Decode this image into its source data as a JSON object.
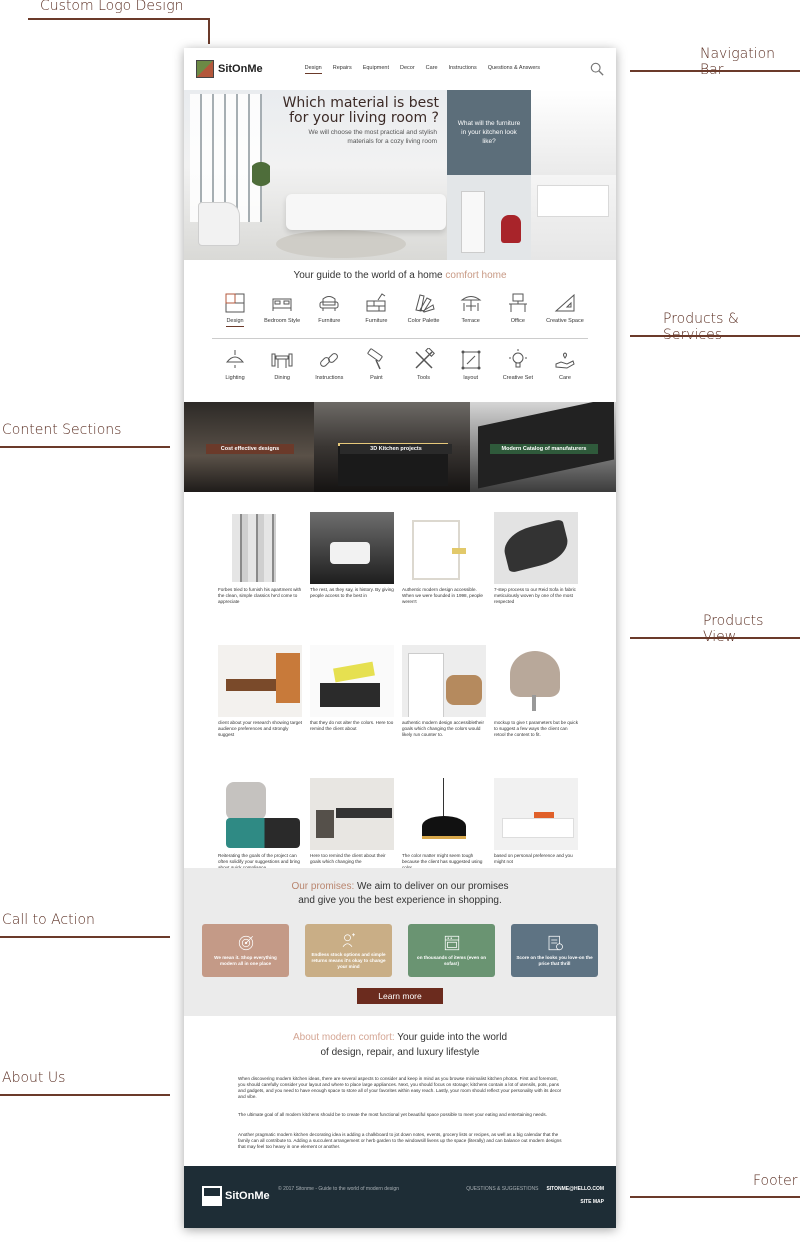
{
  "annotations": {
    "logo": "Custom Logo Design",
    "nav": "Navigation Bar",
    "products_services": "Products & Services",
    "content_sections": "Content Sections",
    "products_view": "Products View",
    "cta": "Call to Action",
    "about": "About Us",
    "footer": "Footer"
  },
  "nav": {
    "logo_text": "SitOnMe",
    "links": [
      "Design",
      "Repairs",
      "Equipment",
      "Decor",
      "Care",
      "Instructions",
      "Questions & Answers"
    ]
  },
  "hero": {
    "title_line1": "Which material is best",
    "title_line2": "for your living room ?",
    "subtitle": "We will choose the most practical and stylish materials for a cozy living room",
    "side_tile": "What will the furniture in your kitchen look like?"
  },
  "guide": {
    "title_prefix": "Your guide to the world of a home",
    "title_accent": "comfort home",
    "row1": [
      "Design",
      "Bedroom Style",
      "Furniture",
      "Furniture",
      "Color Palette",
      "Terrace",
      "Office",
      "Creative Space"
    ],
    "row2": [
      "Lighting",
      "Dining",
      "Instructions",
      "Paint",
      "Tools",
      "layout",
      "Creative Set",
      "Care"
    ]
  },
  "banners": [
    "Cost effective designs",
    "3D Kitchen projects",
    "Modern Catalog of manufaturers"
  ],
  "products": [
    "Forbes tried to furnish his apartment with the clean, simple classics he'd come to appreciate",
    "The rest, as they say, is history. By giving people access to the best in",
    "Authentic modern design accessible. When we were founded in 1998, people weren't",
    "7-step process to our Reid Sofa in fabric meticulously woven by one of the most respected",
    "client about your research showing target audience preferences and strongly suggest",
    "that they do not alter the colors. Here too remind the client about",
    "authentic modern design accessibletheir goals which changing the colors would likely run counter to.",
    "mockup to give t parameters but be quick to suggest a few ways the client can retool the content to fit.",
    "Reiterating the goals of the project can often solidify your suggestions and bring about quick compliance.",
    "Here too remind the client about their goals which changing the",
    "The color matter might seem tough because the client has suggested using color",
    "based on personal preference and you might not"
  ],
  "promises": {
    "title_accent": "Our promises:",
    "title_rest": "We aim to deliver on our promises",
    "title_line2": "and give you the best experience in shopping.",
    "cards": [
      {
        "text": "We mean it. Shop everything modern all in one place",
        "color": "#c49a87"
      },
      {
        "text": "Endless stock options and simple returns means it's okay to change your mind",
        "color": "#c9ae86"
      },
      {
        "text": "on thousands of items (even on sofas!)",
        "color": "#6a9472"
      },
      {
        "text": "Score on the looks you love-on the price that thrill",
        "color": "#5e7383"
      }
    ],
    "button": "Learn more"
  },
  "about": {
    "title_accent": "About modern comfort:",
    "title_rest": "Your guide into the world",
    "title_line2": "of design, repair, and luxury lifestyle",
    "p1": "When discovering modern kitchen ideas, there are several aspects to consider and keep in mind as you browse minimalist kitchen photos. First and foremost, you should carefully consider your layout and where to place large appliances. Next, you should focus on storage; kitchens contain a lot of utensils, pots, pans and gadgets, and you need to have enough space to store all of your favorites within easy reach. Lastly, your room should reflect your personality with its decor and vibe.",
    "p2": "The ultimate goal of all modern kitchens should be to create the most functional yet beautiful space possible to meet your eating and entertaining needs.",
    "p3": "Another pragmatic modern kitchen decorating idea is adding a chalkboard to jot down notes, events, grocery lists or recipes, as well as a big calendar that the family can all contribute to. Adding a succulent arrangement or herb garden to the windowsill livens up the space (literally) and can balance out modern designs that may feel too heavy in one element or another."
  },
  "footer": {
    "logo_text": "SitOnMe",
    "copyright": "© 2017 Sitonme - Guide to the world of modern design",
    "questions": "QUESTIONS & SUGGESTIONS",
    "email": "SITONME@HELLO.COM",
    "sitemap": "SITE MAP"
  }
}
